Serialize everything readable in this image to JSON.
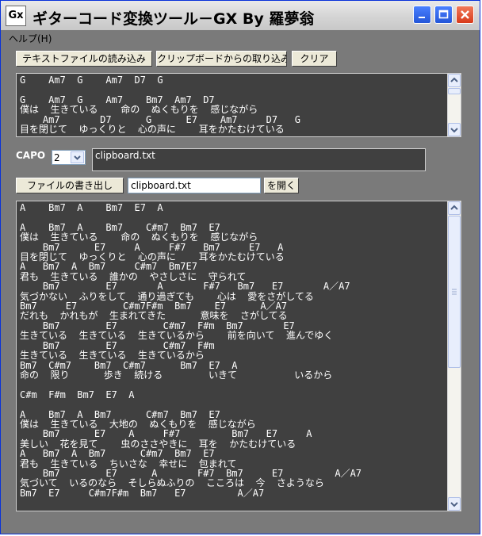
{
  "window": {
    "title": "ギターコード変換ツール－GX By 羅夢翁",
    "icon_text": "Gx"
  },
  "menu": {
    "help": "ヘルプ(H)"
  },
  "toolbar": {
    "load_file": "テキストファイルの読み込み",
    "load_clipboard": "クリップボードからの取り込み",
    "clear": "クリア"
  },
  "input_text": "G    Am7  G    Am7  D7  G\n\nG    Am7  G    Am7    Bm7  Am7  D7\n僕は  生きている    命の  ぬくもりを  感じながら\n    Am7       D7      G      E7    Am7     D7   G\n目を閉じて  ゆっくりと  心の声に    耳をかたむけている",
  "capo": {
    "label": "CAPO",
    "value": "2",
    "source_name": "clipboard.txt"
  },
  "export": {
    "write_label": "ファイルの書き出し",
    "filename": "clipboard.txt",
    "open_label": "を開く"
  },
  "output_text": "A    Bm7  A    Bm7  E7  A\n\nA    Bm7  A    Bm7    C#m7  Bm7  E7\n僕は  生きている    命の  ぬくもりを  感じながら\n    Bm7      E7     A     F#7   Bm7     E7   A\n目を閉じて  ゆっくりと  心の声に    耳をかたむけている\nA   Bm7  A  Bm7     C#m7  Bm7E7\n君も  生きている  誰かの  やさしさに  守られて\n    Bm7        E7       A       F#7   Bm7   E7       A／A7\n気づかない  ふりをして  通り過ぎても    心は  愛をさがしてる\nBm7     E7        C#m7F#m  Bm7    E7      A／A7\nだれも  かれもが  生まれてきた      意味を  さがしてる\n    Bm7        E7        C#m7  F#m  Bm7       E7\n生きている  生きている  生きているから    前を向いて  進んでゆく\n    Bm7        E7        C#m7  F#m\n生きている  生きている  生きているから\nBm7  C#m7    Bm7  C#m7      Bm7  E7  A\n命の  限り      歩き  続ける        いきて          いるから\n\nC#m  F#m  Bm7  E7  A\n\nA    Bm7  A  Bm7      C#m7  Bm7  E7\n僕は  生きている  大地の  ぬくもりを  感じながら\n    Bm7      E7    A     F#7         Bm7   E7     A\n美しい  花を見て    虫のささやきに  耳を  かたむけている\nA   Bm7  A  Bm7      C#m7  Bm7  E7\n君も  生きている  ちいさな  幸せに  包まれて\n    Bm7        E7      A       F#7  Bm7     E7         A／A7\n気づいて  いるのなら  そしらぬふりの  こころは  今  さようなら\nBm7  E7     C#m7F#m  Bm7   E7         A／A7"
}
